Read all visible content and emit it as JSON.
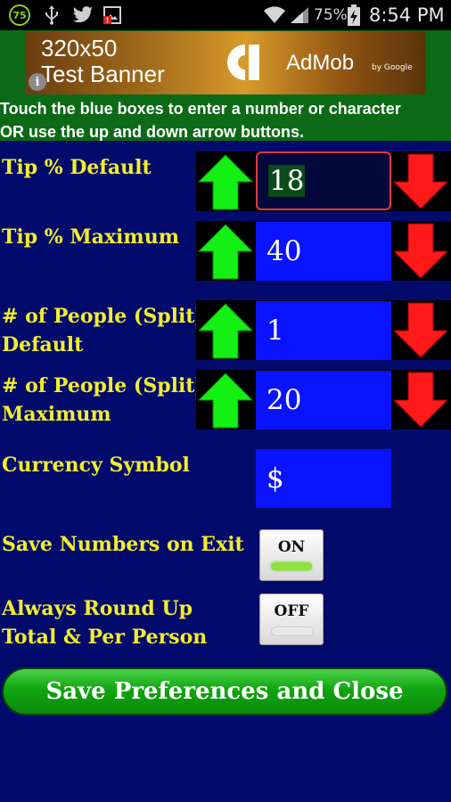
{
  "status_bar": {
    "circle_badge": "75",
    "battery_percent": "75%",
    "time": "8:54 PM",
    "icons": [
      "usb-icon",
      "twitter-icon",
      "image-error-icon",
      "wifi-icon",
      "signal-icon",
      "battery-charging-icon"
    ]
  },
  "ad": {
    "banner_line1": "320x50",
    "banner_line2": "Test Banner",
    "brand": "AdMob",
    "byline": "by Google"
  },
  "instructions": {
    "line1": "Touch the blue boxes to enter a number or character",
    "line2": "OR use the up and down arrow buttons."
  },
  "settings": {
    "tip_default": {
      "label": "Tip % Default",
      "value": "18"
    },
    "tip_maximum": {
      "label": "Tip % Maximum",
      "value": "40"
    },
    "people_default": {
      "label_line1": "# of People (Split)",
      "label_line2": "Default",
      "value": "1"
    },
    "people_maximum": {
      "label_line1": "# of People (Split)",
      "label_line2": "Maximum",
      "value": "20"
    },
    "currency": {
      "label": "Currency Symbol",
      "value": "$"
    },
    "save_on_exit": {
      "label": "Save Numbers on Exit",
      "state": "ON"
    },
    "round_up": {
      "label_line1": "Always Round Up",
      "label_line2": "Total & Per Person",
      "state": "OFF"
    }
  },
  "save_button": {
    "label": "Save Preferences and Close"
  },
  "colors": {
    "background": "#020b6b",
    "header_green": "#0c6a16",
    "label_yellow": "#f4ee2a",
    "value_blue": "#0a13ff",
    "arrow_up_green": "#14f014",
    "arrow_down_red": "#ff1a1a"
  }
}
